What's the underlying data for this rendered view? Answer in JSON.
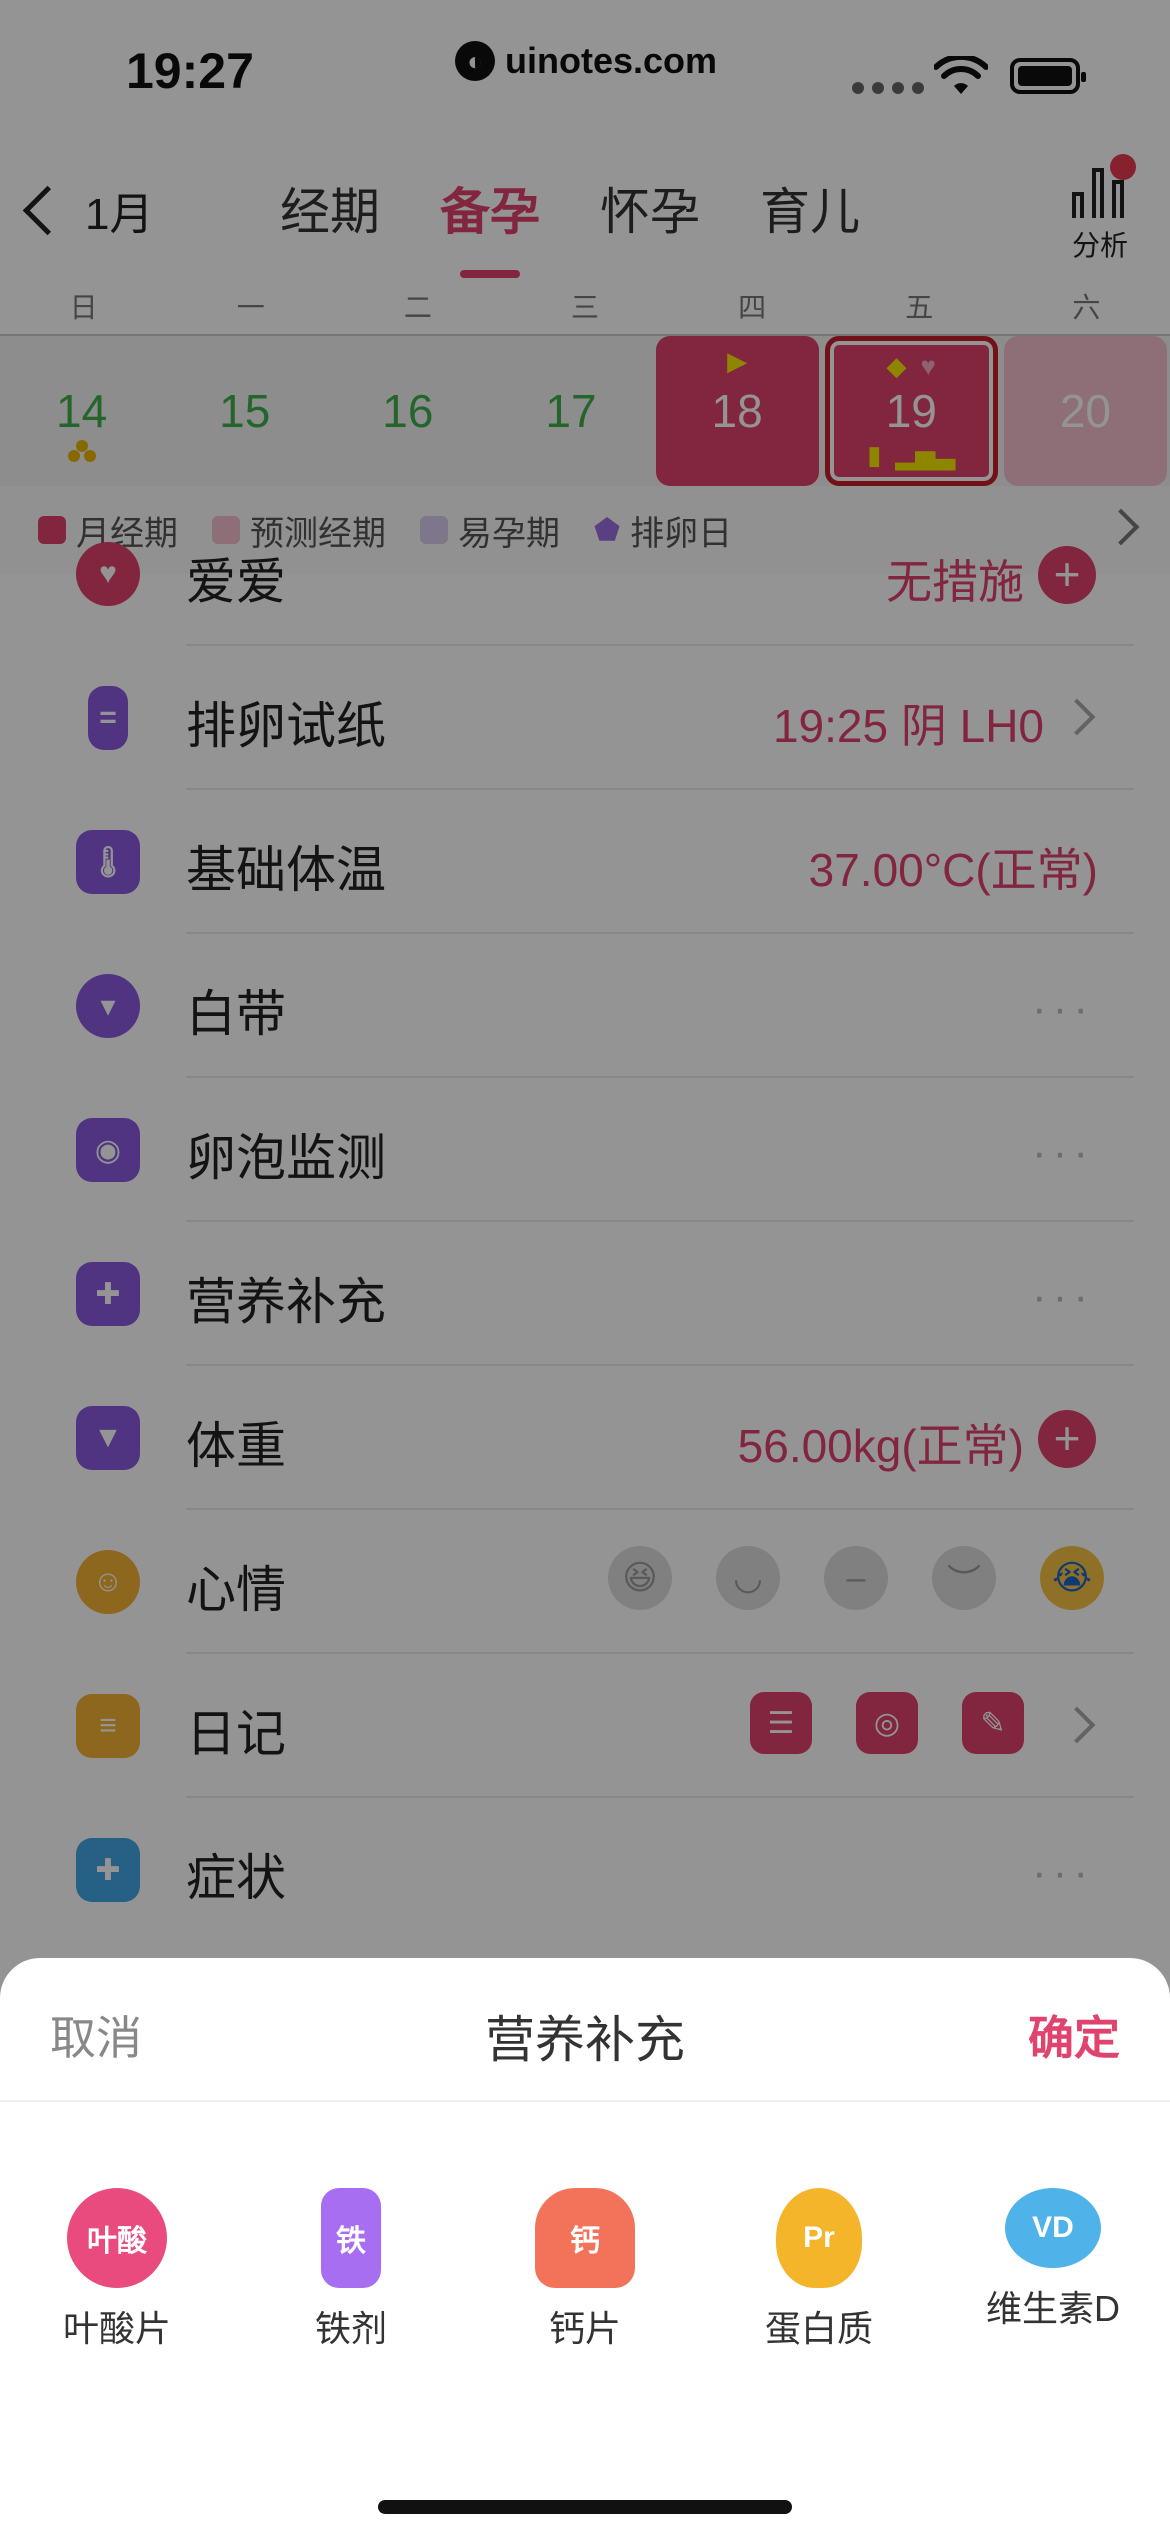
{
  "status_bar": {
    "time": "19:27",
    "watermark": "uinotes.com"
  },
  "nav": {
    "back_label": "1月",
    "tabs": [
      {
        "label": "经期",
        "active": false
      },
      {
        "label": "备孕",
        "active": true
      },
      {
        "label": "怀孕",
        "active": false
      },
      {
        "label": "育儿",
        "active": false
      }
    ],
    "analysis_label": "分析"
  },
  "calendar": {
    "weekdays": [
      "日",
      "一",
      "二",
      "三",
      "四",
      "五",
      "六"
    ],
    "days": [
      "14",
      "15",
      "16",
      "17",
      "18",
      "19",
      "20"
    ]
  },
  "legend": {
    "items": [
      {
        "label": "月经期",
        "color": "#e0436e"
      },
      {
        "label": "预测经期",
        "color": "#f4c0cd"
      },
      {
        "label": "易孕期",
        "color": "#d9cef0"
      },
      {
        "label": "排卵日",
        "color": "#9b6fe0"
      }
    ]
  },
  "records": {
    "love": {
      "label": "爱爱",
      "value": "无措施"
    },
    "ovulation_test": {
      "label": "排卵试纸",
      "value": "19:25 阴 LH0"
    },
    "bbt": {
      "label": "基础体温",
      "value": "37.00°C(正常)"
    },
    "discharge": {
      "label": "白带"
    },
    "follicle": {
      "label": "卵泡监测"
    },
    "nutrition": {
      "label": "营养补充"
    },
    "weight": {
      "label": "体重",
      "value": "56.00kg(正常)"
    },
    "mood": {
      "label": "心情"
    },
    "diary": {
      "label": "日记"
    },
    "symptoms": {
      "label": "症状"
    },
    "more_glyph": "···",
    "plus_glyph": "+"
  },
  "sheet": {
    "cancel": "取消",
    "title": "营养补充",
    "confirm": "确定",
    "items": [
      {
        "label": "叶酸片",
        "icon_text": "叶酸"
      },
      {
        "label": "铁剂",
        "icon_text": "铁"
      },
      {
        "label": "钙片",
        "icon_text": "钙"
      },
      {
        "label": "蛋白质",
        "icon_text": "Pr"
      },
      {
        "label": "维生素D",
        "icon_text": "VD"
      }
    ]
  }
}
